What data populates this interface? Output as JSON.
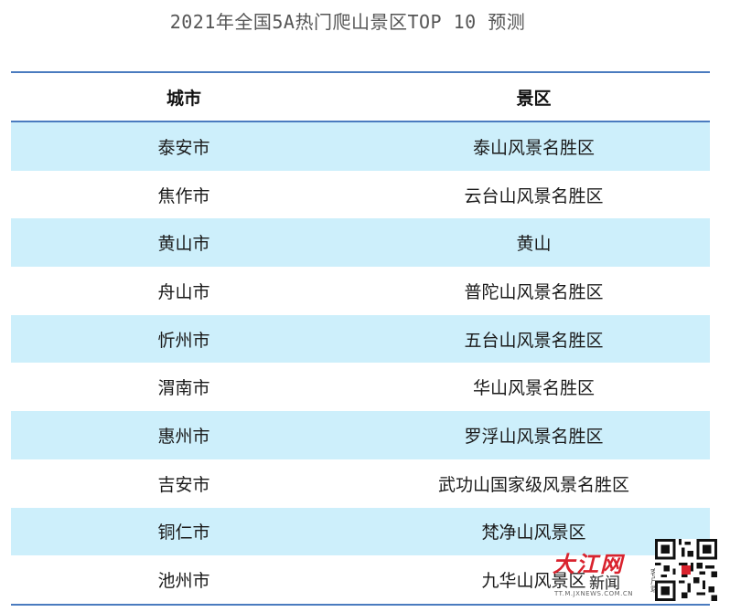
{
  "title": "2021年全国5A热门爬山景区TOP 10 预测",
  "table": {
    "headers": {
      "city": "城市",
      "site": "景区"
    },
    "rows": [
      {
        "city": "泰安市",
        "site": "泰山风景名胜区"
      },
      {
        "city": "焦作市",
        "site": "云台山风景名胜区"
      },
      {
        "city": "黄山市",
        "site": "黄山"
      },
      {
        "city": "舟山市",
        "site": "普陀山风景名胜区"
      },
      {
        "city": "忻州市",
        "site": "五台山风景名胜区"
      },
      {
        "city": "渭南市",
        "site": "华山风景名胜区"
      },
      {
        "city": "惠州市",
        "site": "罗浮山风景名胜区"
      },
      {
        "city": "吉安市",
        "site": "武功山国家级风景名胜区"
      },
      {
        "city": "铜仁市",
        "site": "梵净山风景区"
      },
      {
        "city": "池州市",
        "site": "九华山风景区"
      }
    ]
  },
  "watermark": {
    "logo": "大江网",
    "news": "新闻",
    "side": "客户端",
    "url": "TT.M.JXNEWS.COM.CN"
  },
  "colors": {
    "rule": "#4a7bbf",
    "stripe": "#cdeffb",
    "brand_red": "#d9232e"
  }
}
